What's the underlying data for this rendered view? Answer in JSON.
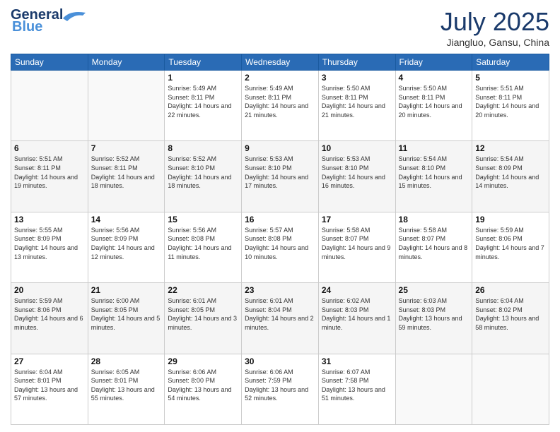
{
  "header": {
    "logo_general": "General",
    "logo_blue": "Blue",
    "month": "July 2025",
    "location": "Jiangluo, Gansu, China"
  },
  "days_of_week": [
    "Sunday",
    "Monday",
    "Tuesday",
    "Wednesday",
    "Thursday",
    "Friday",
    "Saturday"
  ],
  "weeks": [
    [
      {
        "day": "",
        "info": ""
      },
      {
        "day": "",
        "info": ""
      },
      {
        "day": "1",
        "info": "Sunrise: 5:49 AM\nSunset: 8:11 PM\nDaylight: 14 hours and 22 minutes."
      },
      {
        "day": "2",
        "info": "Sunrise: 5:49 AM\nSunset: 8:11 PM\nDaylight: 14 hours and 21 minutes."
      },
      {
        "day": "3",
        "info": "Sunrise: 5:50 AM\nSunset: 8:11 PM\nDaylight: 14 hours and 21 minutes."
      },
      {
        "day": "4",
        "info": "Sunrise: 5:50 AM\nSunset: 8:11 PM\nDaylight: 14 hours and 20 minutes."
      },
      {
        "day": "5",
        "info": "Sunrise: 5:51 AM\nSunset: 8:11 PM\nDaylight: 14 hours and 20 minutes."
      }
    ],
    [
      {
        "day": "6",
        "info": "Sunrise: 5:51 AM\nSunset: 8:11 PM\nDaylight: 14 hours and 19 minutes."
      },
      {
        "day": "7",
        "info": "Sunrise: 5:52 AM\nSunset: 8:11 PM\nDaylight: 14 hours and 18 minutes."
      },
      {
        "day": "8",
        "info": "Sunrise: 5:52 AM\nSunset: 8:10 PM\nDaylight: 14 hours and 18 minutes."
      },
      {
        "day": "9",
        "info": "Sunrise: 5:53 AM\nSunset: 8:10 PM\nDaylight: 14 hours and 17 minutes."
      },
      {
        "day": "10",
        "info": "Sunrise: 5:53 AM\nSunset: 8:10 PM\nDaylight: 14 hours and 16 minutes."
      },
      {
        "day": "11",
        "info": "Sunrise: 5:54 AM\nSunset: 8:10 PM\nDaylight: 14 hours and 15 minutes."
      },
      {
        "day": "12",
        "info": "Sunrise: 5:54 AM\nSunset: 8:09 PM\nDaylight: 14 hours and 14 minutes."
      }
    ],
    [
      {
        "day": "13",
        "info": "Sunrise: 5:55 AM\nSunset: 8:09 PM\nDaylight: 14 hours and 13 minutes."
      },
      {
        "day": "14",
        "info": "Sunrise: 5:56 AM\nSunset: 8:09 PM\nDaylight: 14 hours and 12 minutes."
      },
      {
        "day": "15",
        "info": "Sunrise: 5:56 AM\nSunset: 8:08 PM\nDaylight: 14 hours and 11 minutes."
      },
      {
        "day": "16",
        "info": "Sunrise: 5:57 AM\nSunset: 8:08 PM\nDaylight: 14 hours and 10 minutes."
      },
      {
        "day": "17",
        "info": "Sunrise: 5:58 AM\nSunset: 8:07 PM\nDaylight: 14 hours and 9 minutes."
      },
      {
        "day": "18",
        "info": "Sunrise: 5:58 AM\nSunset: 8:07 PM\nDaylight: 14 hours and 8 minutes."
      },
      {
        "day": "19",
        "info": "Sunrise: 5:59 AM\nSunset: 8:06 PM\nDaylight: 14 hours and 7 minutes."
      }
    ],
    [
      {
        "day": "20",
        "info": "Sunrise: 5:59 AM\nSunset: 8:06 PM\nDaylight: 14 hours and 6 minutes."
      },
      {
        "day": "21",
        "info": "Sunrise: 6:00 AM\nSunset: 8:05 PM\nDaylight: 14 hours and 5 minutes."
      },
      {
        "day": "22",
        "info": "Sunrise: 6:01 AM\nSunset: 8:05 PM\nDaylight: 14 hours and 3 minutes."
      },
      {
        "day": "23",
        "info": "Sunrise: 6:01 AM\nSunset: 8:04 PM\nDaylight: 14 hours and 2 minutes."
      },
      {
        "day": "24",
        "info": "Sunrise: 6:02 AM\nSunset: 8:03 PM\nDaylight: 14 hours and 1 minute."
      },
      {
        "day": "25",
        "info": "Sunrise: 6:03 AM\nSunset: 8:03 PM\nDaylight: 13 hours and 59 minutes."
      },
      {
        "day": "26",
        "info": "Sunrise: 6:04 AM\nSunset: 8:02 PM\nDaylight: 13 hours and 58 minutes."
      }
    ],
    [
      {
        "day": "27",
        "info": "Sunrise: 6:04 AM\nSunset: 8:01 PM\nDaylight: 13 hours and 57 minutes."
      },
      {
        "day": "28",
        "info": "Sunrise: 6:05 AM\nSunset: 8:01 PM\nDaylight: 13 hours and 55 minutes."
      },
      {
        "day": "29",
        "info": "Sunrise: 6:06 AM\nSunset: 8:00 PM\nDaylight: 13 hours and 54 minutes."
      },
      {
        "day": "30",
        "info": "Sunrise: 6:06 AM\nSunset: 7:59 PM\nDaylight: 13 hours and 52 minutes."
      },
      {
        "day": "31",
        "info": "Sunrise: 6:07 AM\nSunset: 7:58 PM\nDaylight: 13 hours and 51 minutes."
      },
      {
        "day": "",
        "info": ""
      },
      {
        "day": "",
        "info": ""
      }
    ]
  ]
}
